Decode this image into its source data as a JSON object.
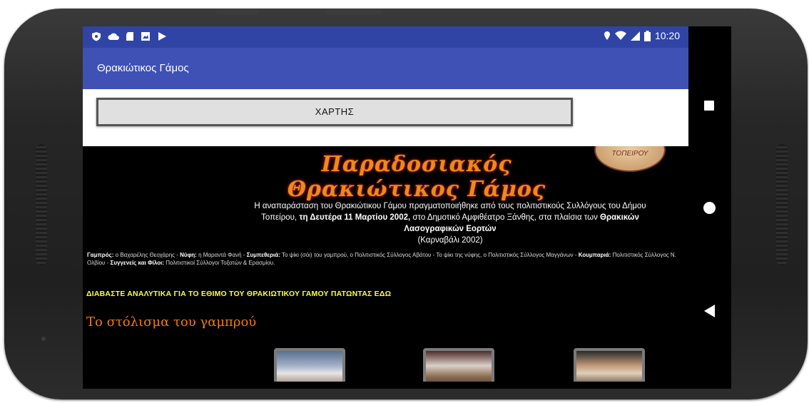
{
  "status_bar": {
    "time": "10:20",
    "left_icons": [
      "shield-icon",
      "cloud-icon",
      "sd-card-icon",
      "image-icon",
      "play-store-icon"
    ],
    "right_icons": [
      "location-icon",
      "wifi-icon",
      "signal-icon",
      "battery-icon"
    ]
  },
  "app_bar": {
    "title": "Θρακιώτικος Γάμος"
  },
  "maps_button": {
    "label": "ΧΑΡΤΗΣ"
  },
  "web": {
    "title": "Παραδοσιακός Θρακιώτικος Γάμος",
    "seal_text": "ΤΟΠΕΙΡΟΥ",
    "intro": {
      "p1": "Η αναπαράσταση του Θρακιώτικου Γάμου πραγματοποιήθηκε από τους πολιτιστικούς Συλλόγους του Δήμου Τοπείρου,",
      "b1": "τη Δευτέρα 11 Μαρτίου 2002,",
      "p2": "στο Δημοτικό Αμφιθέατρο Ξάνθης, στα πλαίσια των",
      "b2": "Θρακικών Λασογραφικών Εορτών",
      "p3": "(Καρναβάλι 2002)"
    },
    "credits": [
      {
        "label": "Γαμπρός:",
        "text": "ο Βαχαρέλης Θεοχάρης -"
      },
      {
        "label": "Νύφη:",
        "text": "η Μαραντά Φανή -"
      },
      {
        "label": "Συμπεθεριά:",
        "text": "Το ψίκι (σόι) του γαμπρού, ο Πολιτιστικός Σύλλογος Αβάτου - Το ψίκι της νύφης, ο Πολιτιστικός Σύλλογος Μαγγάνων -"
      },
      {
        "label": "Κουμπαριά:",
        "text": "Πολιτιστικός Σύλλογος Ν. Ολβίου -"
      },
      {
        "label": "Συγγενείς και Φίλοι:",
        "text": "Πολιτιστικοί Σύλλογοι Τοξοτών & Ερασμίου."
      }
    ],
    "read_more": "ΔΙΑΒΑΣΤΕ ΑΝΑΛΥΤΙΚΑ ΓΙΑ ΤΟ ΕΘΙΜΟ ΤΟΥ ΘΡΑΚΙΩΤΙΚΟΥ ΓΑΜΟΥ ΠΑΤΩΝΤΑΣ ΕΔΩ",
    "section_title": "Το στόλισμα του γαμπρού"
  },
  "nav_bar": [
    "recents-icon",
    "home-icon",
    "back-icon"
  ],
  "colors": {
    "status_bar": "#2f44a5",
    "app_bar": "#3f51b5",
    "title": "#f08a10",
    "link": "#ffff33"
  }
}
